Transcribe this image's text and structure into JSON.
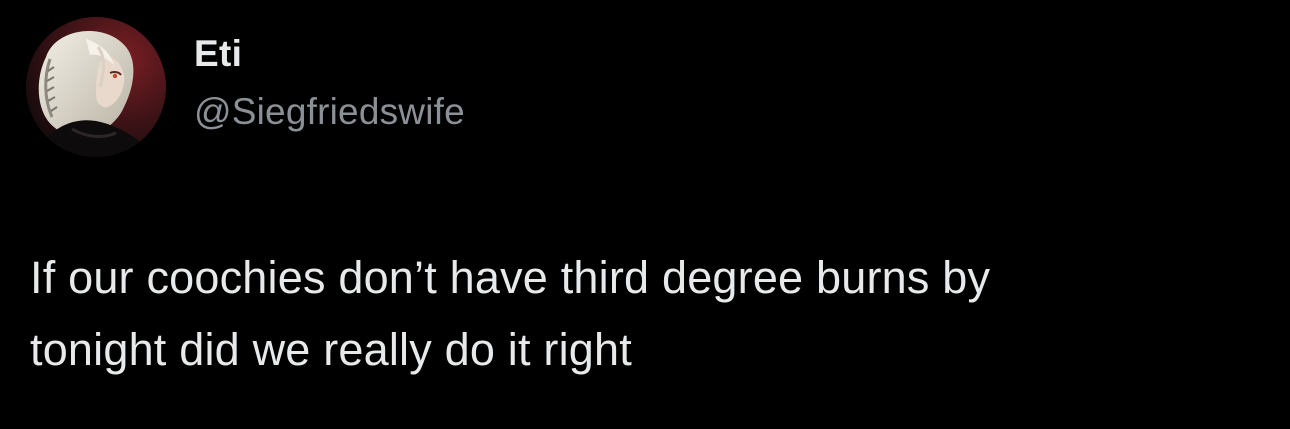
{
  "tweet": {
    "author": {
      "display_name": "Eti",
      "handle": "@Siegfriedswife",
      "avatar_icon": "anime-character-avatar"
    },
    "text": "If our coochies don’t have third degree burns by\ntonight did we really do it right"
  },
  "colors": {
    "background": "#000000",
    "primary_text": "#e7e9ea",
    "secondary_text": "#8b9096"
  }
}
